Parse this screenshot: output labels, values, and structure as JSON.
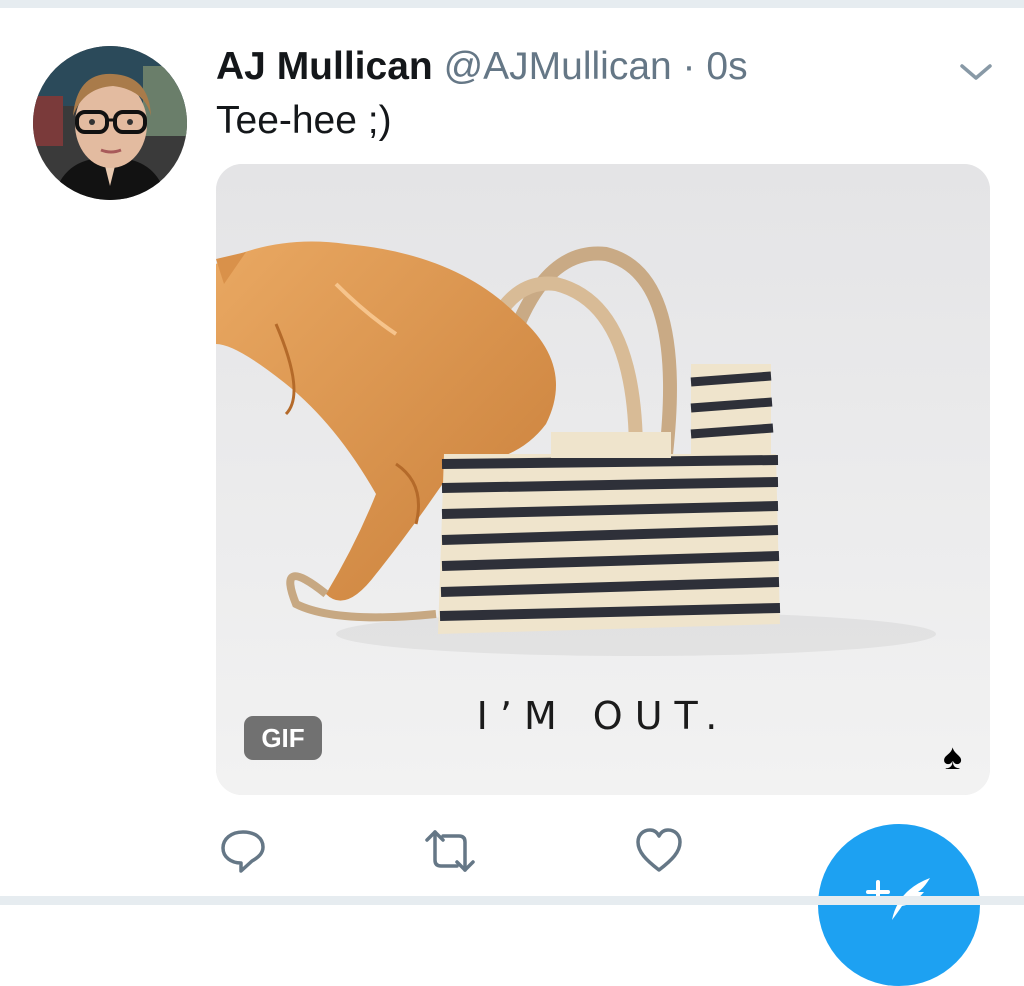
{
  "tweet": {
    "author_name": "AJ Mullican",
    "handle": "@AJMullican",
    "separator": " · ",
    "timestamp": "0s",
    "text": "Tee-hee ;)",
    "media": {
      "caption": "I’M OUT.",
      "badge": "GIF",
      "brand_icon": "spade-icon"
    },
    "actions": {
      "reply_icon": "reply-icon",
      "retweet_icon": "retweet-icon",
      "like_icon": "heart-icon"
    }
  },
  "fab": {
    "icon": "compose-tweet-icon",
    "symbol": "+"
  },
  "colors": {
    "accent": "#1da1f2",
    "text_primary": "#14171a",
    "text_secondary": "#657786",
    "icon": "#657786",
    "divider": "#e6ecf0"
  }
}
